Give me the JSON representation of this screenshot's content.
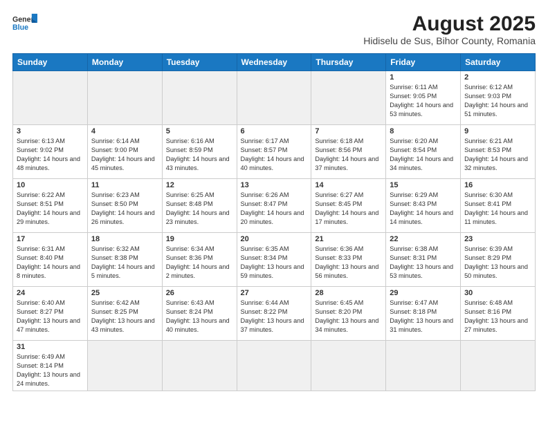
{
  "header": {
    "logo_line1": "General",
    "logo_line2": "Blue",
    "title": "August 2025",
    "subtitle": "Hidiselu de Sus, Bihor County, Romania"
  },
  "weekdays": [
    "Sunday",
    "Monday",
    "Tuesday",
    "Wednesday",
    "Thursday",
    "Friday",
    "Saturday"
  ],
  "weeks": [
    [
      {
        "num": "",
        "info": ""
      },
      {
        "num": "",
        "info": ""
      },
      {
        "num": "",
        "info": ""
      },
      {
        "num": "",
        "info": ""
      },
      {
        "num": "",
        "info": ""
      },
      {
        "num": "1",
        "info": "Sunrise: 6:11 AM\nSunset: 9:05 PM\nDaylight: 14 hours and 53 minutes."
      },
      {
        "num": "2",
        "info": "Sunrise: 6:12 AM\nSunset: 9:03 PM\nDaylight: 14 hours and 51 minutes."
      }
    ],
    [
      {
        "num": "3",
        "info": "Sunrise: 6:13 AM\nSunset: 9:02 PM\nDaylight: 14 hours and 48 minutes."
      },
      {
        "num": "4",
        "info": "Sunrise: 6:14 AM\nSunset: 9:00 PM\nDaylight: 14 hours and 45 minutes."
      },
      {
        "num": "5",
        "info": "Sunrise: 6:16 AM\nSunset: 8:59 PM\nDaylight: 14 hours and 43 minutes."
      },
      {
        "num": "6",
        "info": "Sunrise: 6:17 AM\nSunset: 8:57 PM\nDaylight: 14 hours and 40 minutes."
      },
      {
        "num": "7",
        "info": "Sunrise: 6:18 AM\nSunset: 8:56 PM\nDaylight: 14 hours and 37 minutes."
      },
      {
        "num": "8",
        "info": "Sunrise: 6:20 AM\nSunset: 8:54 PM\nDaylight: 14 hours and 34 minutes."
      },
      {
        "num": "9",
        "info": "Sunrise: 6:21 AM\nSunset: 8:53 PM\nDaylight: 14 hours and 32 minutes."
      }
    ],
    [
      {
        "num": "10",
        "info": "Sunrise: 6:22 AM\nSunset: 8:51 PM\nDaylight: 14 hours and 29 minutes."
      },
      {
        "num": "11",
        "info": "Sunrise: 6:23 AM\nSunset: 8:50 PM\nDaylight: 14 hours and 26 minutes."
      },
      {
        "num": "12",
        "info": "Sunrise: 6:25 AM\nSunset: 8:48 PM\nDaylight: 14 hours and 23 minutes."
      },
      {
        "num": "13",
        "info": "Sunrise: 6:26 AM\nSunset: 8:47 PM\nDaylight: 14 hours and 20 minutes."
      },
      {
        "num": "14",
        "info": "Sunrise: 6:27 AM\nSunset: 8:45 PM\nDaylight: 14 hours and 17 minutes."
      },
      {
        "num": "15",
        "info": "Sunrise: 6:29 AM\nSunset: 8:43 PM\nDaylight: 14 hours and 14 minutes."
      },
      {
        "num": "16",
        "info": "Sunrise: 6:30 AM\nSunset: 8:41 PM\nDaylight: 14 hours and 11 minutes."
      }
    ],
    [
      {
        "num": "17",
        "info": "Sunrise: 6:31 AM\nSunset: 8:40 PM\nDaylight: 14 hours and 8 minutes."
      },
      {
        "num": "18",
        "info": "Sunrise: 6:32 AM\nSunset: 8:38 PM\nDaylight: 14 hours and 5 minutes."
      },
      {
        "num": "19",
        "info": "Sunrise: 6:34 AM\nSunset: 8:36 PM\nDaylight: 14 hours and 2 minutes."
      },
      {
        "num": "20",
        "info": "Sunrise: 6:35 AM\nSunset: 8:34 PM\nDaylight: 13 hours and 59 minutes."
      },
      {
        "num": "21",
        "info": "Sunrise: 6:36 AM\nSunset: 8:33 PM\nDaylight: 13 hours and 56 minutes."
      },
      {
        "num": "22",
        "info": "Sunrise: 6:38 AM\nSunset: 8:31 PM\nDaylight: 13 hours and 53 minutes."
      },
      {
        "num": "23",
        "info": "Sunrise: 6:39 AM\nSunset: 8:29 PM\nDaylight: 13 hours and 50 minutes."
      }
    ],
    [
      {
        "num": "24",
        "info": "Sunrise: 6:40 AM\nSunset: 8:27 PM\nDaylight: 13 hours and 47 minutes."
      },
      {
        "num": "25",
        "info": "Sunrise: 6:42 AM\nSunset: 8:25 PM\nDaylight: 13 hours and 43 minutes."
      },
      {
        "num": "26",
        "info": "Sunrise: 6:43 AM\nSunset: 8:24 PM\nDaylight: 13 hours and 40 minutes."
      },
      {
        "num": "27",
        "info": "Sunrise: 6:44 AM\nSunset: 8:22 PM\nDaylight: 13 hours and 37 minutes."
      },
      {
        "num": "28",
        "info": "Sunrise: 6:45 AM\nSunset: 8:20 PM\nDaylight: 13 hours and 34 minutes."
      },
      {
        "num": "29",
        "info": "Sunrise: 6:47 AM\nSunset: 8:18 PM\nDaylight: 13 hours and 31 minutes."
      },
      {
        "num": "30",
        "info": "Sunrise: 6:48 AM\nSunset: 8:16 PM\nDaylight: 13 hours and 27 minutes."
      }
    ],
    [
      {
        "num": "31",
        "info": "Sunrise: 6:49 AM\nSunset: 8:14 PM\nDaylight: 13 hours and 24 minutes."
      },
      {
        "num": "",
        "info": ""
      },
      {
        "num": "",
        "info": ""
      },
      {
        "num": "",
        "info": ""
      },
      {
        "num": "",
        "info": ""
      },
      {
        "num": "",
        "info": ""
      },
      {
        "num": "",
        "info": ""
      }
    ]
  ]
}
